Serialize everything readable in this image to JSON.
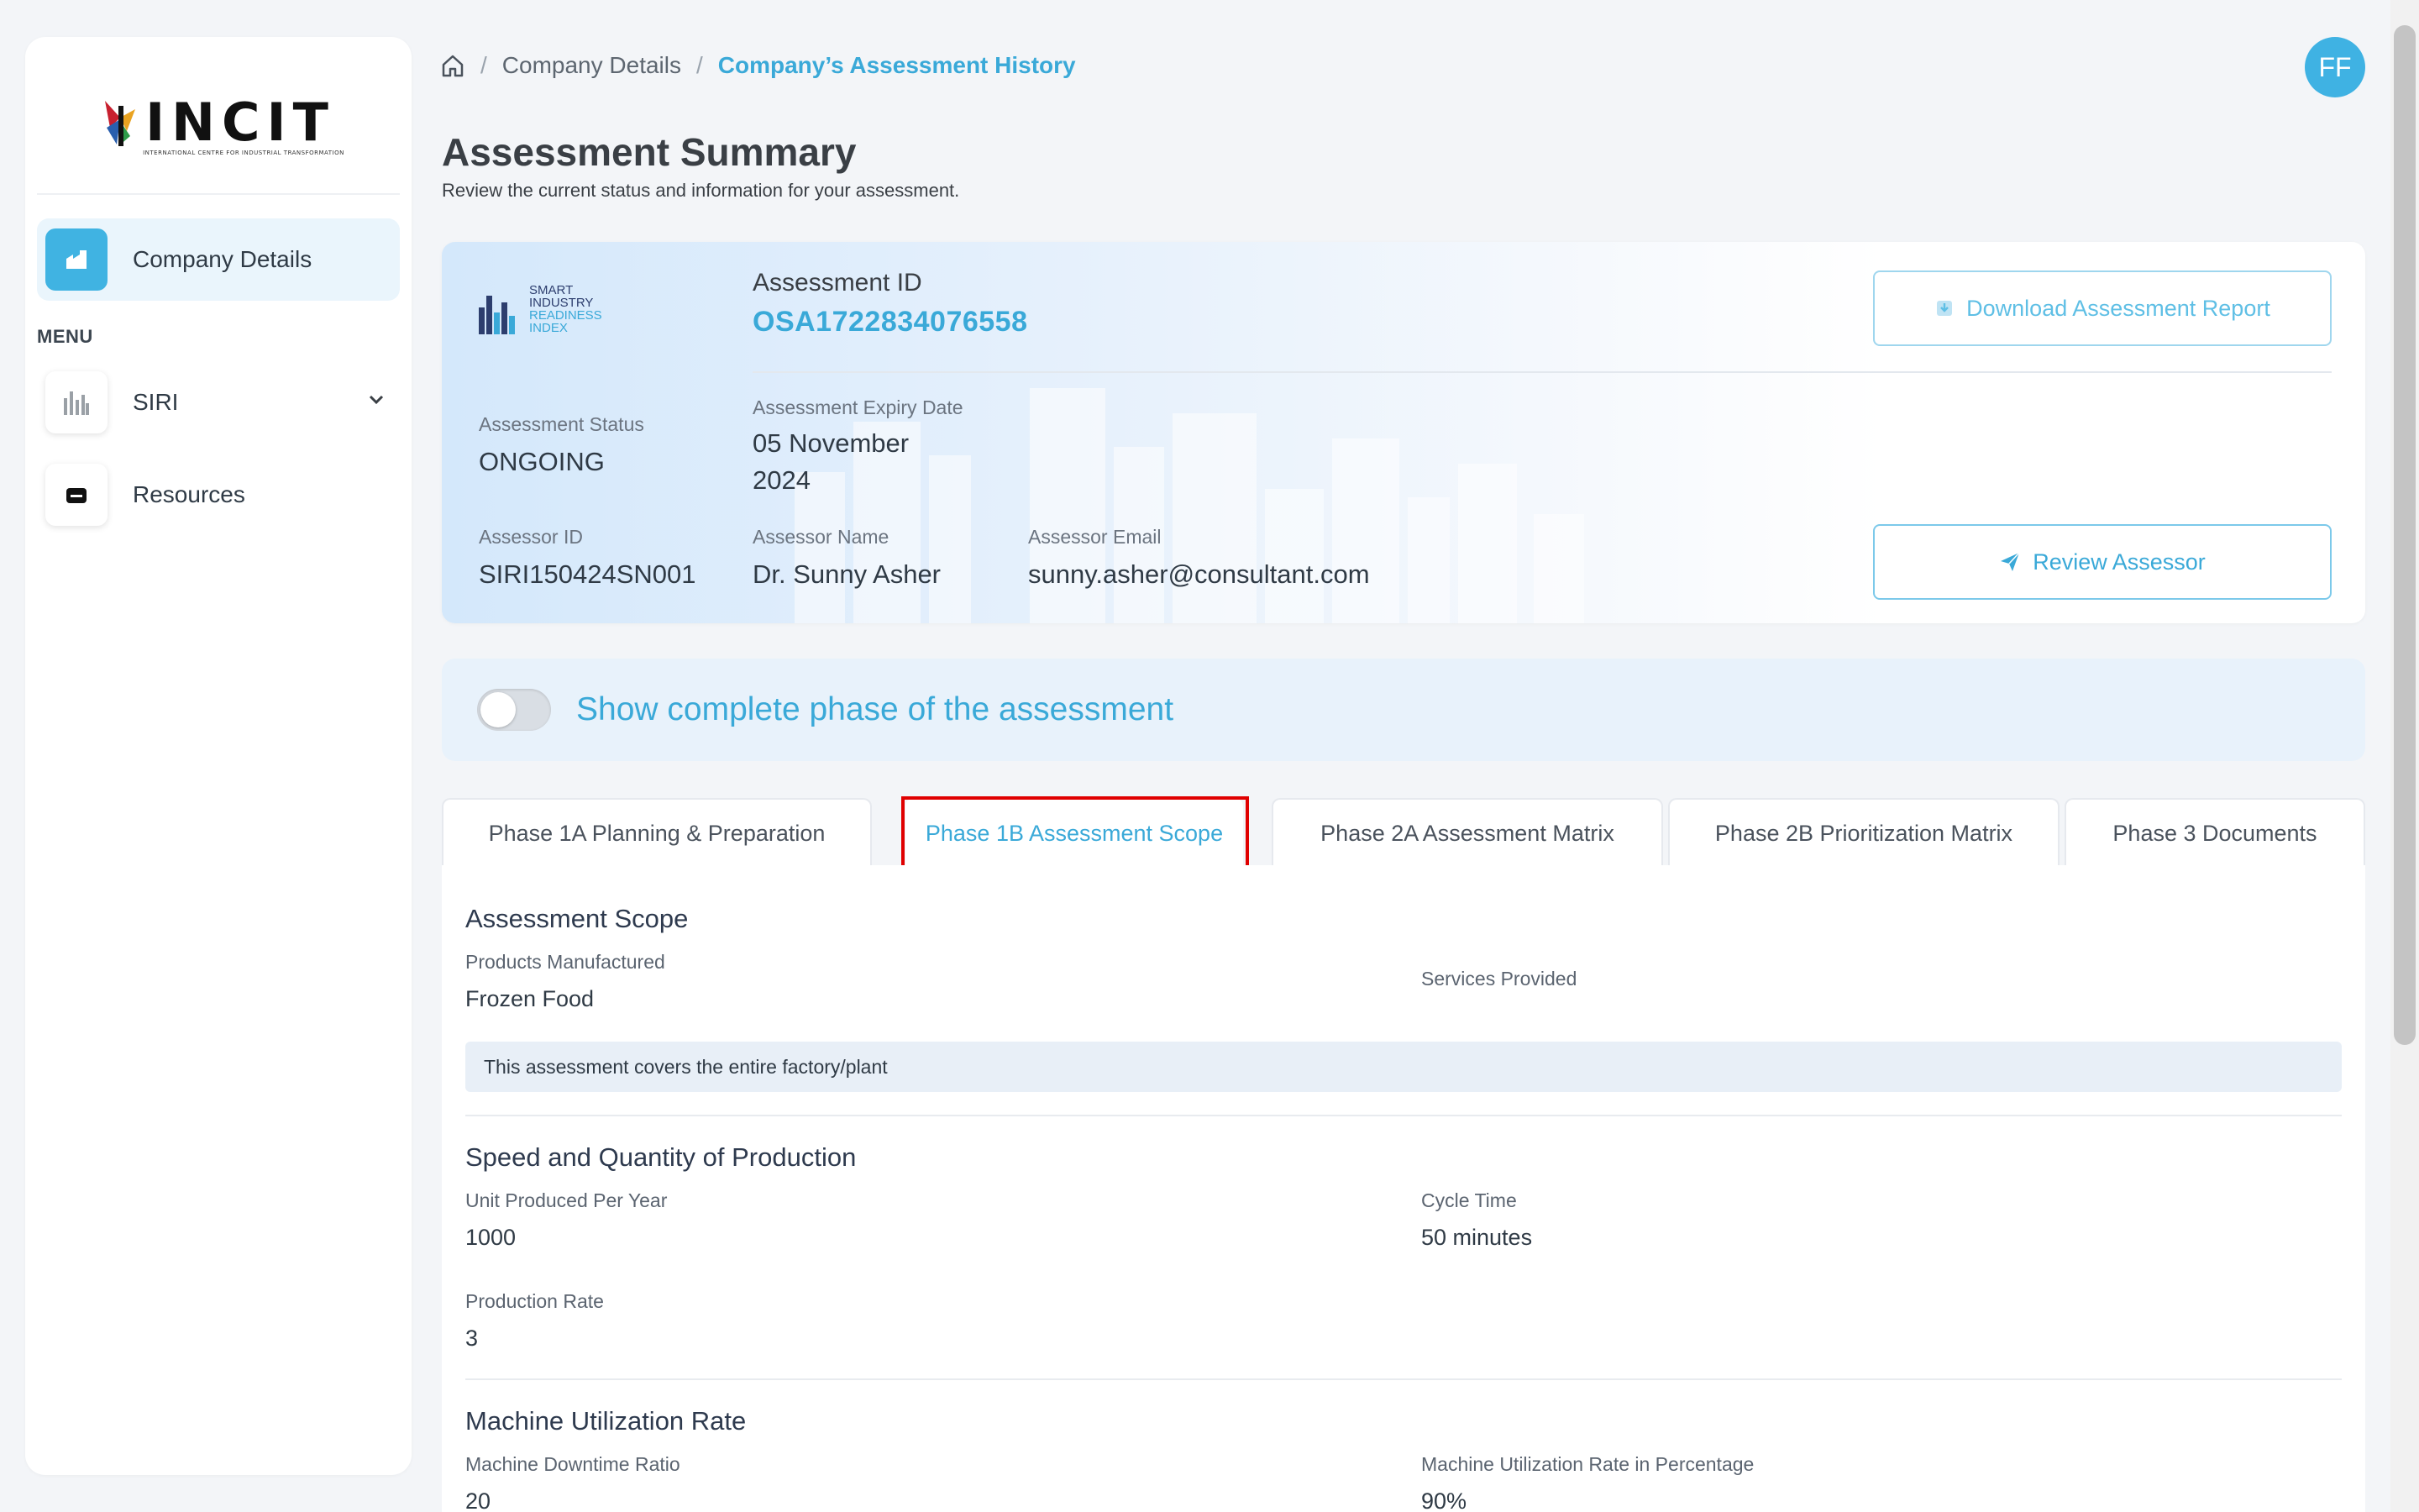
{
  "sidebar": {
    "logo_text": "INCIT",
    "logo_subtitle": "INTERNATIONAL CENTRE FOR INDUSTRIAL TRANSFORMATION",
    "active_item": "Company Details",
    "menu_label": "MENU",
    "items": [
      {
        "label": "SIRI",
        "icon": "bar-chart-icon",
        "expandable": true
      },
      {
        "label": "Resources",
        "icon": "folder-icon",
        "expandable": false
      }
    ]
  },
  "breadcrumb": {
    "items": [
      "Company Details",
      "Company’s Assessment History"
    ]
  },
  "user": {
    "initials": "FF"
  },
  "header": {
    "title": "Assessment Summary",
    "subtitle": "Review the current status and information for your assessment."
  },
  "summary": {
    "siri_logo": [
      "SMART",
      "INDUSTRY",
      "READINESS",
      "INDEX"
    ],
    "assessment_id_label": "Assessment ID",
    "assessment_id": "OSA1722834076558",
    "download_button": "Download Assessment Report",
    "status_label": "Assessment Status",
    "status": "ONGOING",
    "expiry_label": "Assessment Expiry Date",
    "expiry_line1": "05 November",
    "expiry_line2": "2024",
    "assessor_id_label": "Assessor ID",
    "assessor_id": "SIRI150424SN001",
    "assessor_name_label": "Assessor Name",
    "assessor_name": "Dr. Sunny Asher",
    "assessor_email_label": "Assessor Email",
    "assessor_email": "sunny.asher@consultant.com",
    "review_button": "Review Assessor"
  },
  "toggle": {
    "label": "Show complete phase of the assessment",
    "on": false
  },
  "tabs": [
    {
      "label": "Phase 1A Planning & Preparation",
      "active": false
    },
    {
      "label": "Phase 1B Assessment Scope",
      "active": true
    },
    {
      "label": "Phase 2A Assessment Matrix",
      "active": false
    },
    {
      "label": "Phase 2B Prioritization Matrix",
      "active": false
    },
    {
      "label": "Phase 3 Documents",
      "active": false
    }
  ],
  "scope": {
    "title": "Assessment Scope",
    "products_label": "Products Manufactured",
    "products_value": "Frozen Food",
    "services_label": "Services Provided",
    "note": "This assessment covers the entire factory/plant"
  },
  "production": {
    "title": "Speed and Quantity of Production",
    "units_label": "Unit Produced Per Year",
    "units_value": "1000",
    "cycle_label": "Cycle Time",
    "cycle_value": "50 minutes",
    "rate_label": "Production Rate",
    "rate_value": "3"
  },
  "machine": {
    "title": "Machine Utilization Rate",
    "downtime_label": "Machine Downtime Ratio",
    "downtime_value": "20",
    "utilization_label": "Machine Utilization Rate in Percentage",
    "utilization_value": "90%"
  },
  "colors": {
    "accent": "#3aa9d8",
    "highlight": "#e00000"
  }
}
